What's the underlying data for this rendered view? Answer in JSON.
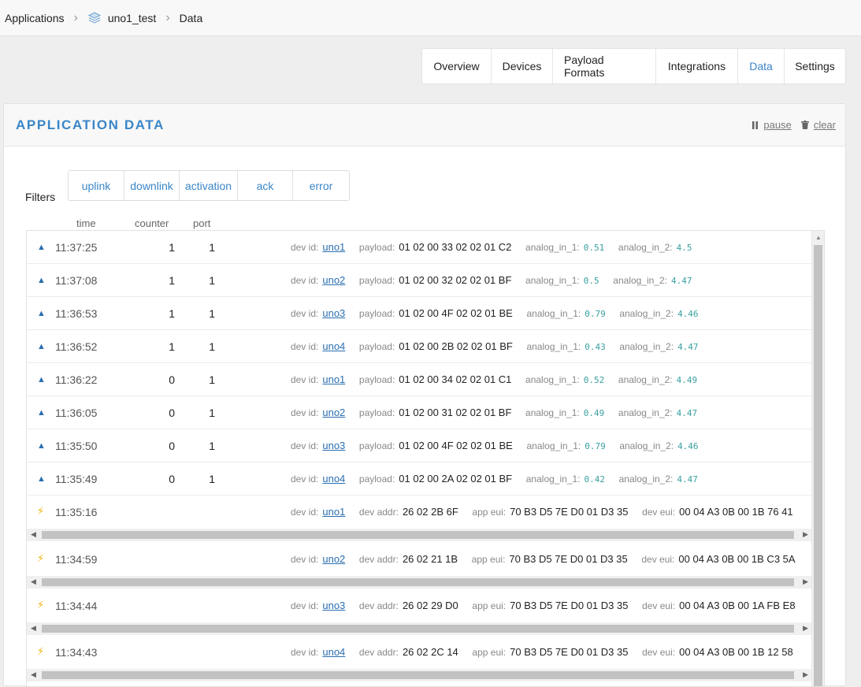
{
  "breadcrumb": {
    "root": "Applications",
    "app": "uno1_test",
    "page": "Data"
  },
  "tabs": [
    {
      "label": "Overview"
    },
    {
      "label": "Devices"
    },
    {
      "label": "Payload Formats"
    },
    {
      "label": "Integrations"
    },
    {
      "label": "Data",
      "active": true
    },
    {
      "label": "Settings"
    }
  ],
  "panel": {
    "title": "APPLICATION DATA",
    "pause_label": "pause",
    "clear_label": "clear"
  },
  "filters": {
    "label": "Filters",
    "items": [
      "uplink",
      "downlink",
      "activation",
      "ack",
      "error"
    ]
  },
  "columns": {
    "time": "time",
    "counter": "counter",
    "port": "port"
  },
  "field_labels": {
    "dev_id": "dev id:",
    "payload": "payload:",
    "analog_in_1": "analog_in_1:",
    "analog_in_2": "analog_in_2:",
    "dev_addr": "dev addr:",
    "app_eui": "app eui:",
    "dev_eui": "dev eui:"
  },
  "uplinks": [
    {
      "time": "11:37:25",
      "counter": "1",
      "port": "1",
      "dev_id": "uno1",
      "payload": "01 02 00 33 02 02 01 C2",
      "analog_in_1": "0.51",
      "analog_in_2": "4.5"
    },
    {
      "time": "11:37:08",
      "counter": "1",
      "port": "1",
      "dev_id": "uno2",
      "payload": "01 02 00 32 02 02 01 BF",
      "analog_in_1": "0.5",
      "analog_in_2": "4.47"
    },
    {
      "time": "11:36:53",
      "counter": "1",
      "port": "1",
      "dev_id": "uno3",
      "payload": "01 02 00 4F 02 02 01 BE",
      "analog_in_1": "0.79",
      "analog_in_2": "4.46"
    },
    {
      "time": "11:36:52",
      "counter": "1",
      "port": "1",
      "dev_id": "uno4",
      "payload": "01 02 00 2B 02 02 01 BF",
      "analog_in_1": "0.43",
      "analog_in_2": "4.47"
    },
    {
      "time": "11:36:22",
      "counter": "0",
      "port": "1",
      "dev_id": "uno1",
      "payload": "01 02 00 34 02 02 01 C1",
      "analog_in_1": "0.52",
      "analog_in_2": "4.49"
    },
    {
      "time": "11:36:05",
      "counter": "0",
      "port": "1",
      "dev_id": "uno2",
      "payload": "01 02 00 31 02 02 01 BF",
      "analog_in_1": "0.49",
      "analog_in_2": "4.47"
    },
    {
      "time": "11:35:50",
      "counter": "0",
      "port": "1",
      "dev_id": "uno3",
      "payload": "01 02 00 4F 02 02 01 BE",
      "analog_in_1": "0.79",
      "analog_in_2": "4.46"
    },
    {
      "time": "11:35:49",
      "counter": "0",
      "port": "1",
      "dev_id": "uno4",
      "payload": "01 02 00 2A 02 02 01 BF",
      "analog_in_1": "0.42",
      "analog_in_2": "4.47"
    }
  ],
  "activations": [
    {
      "time": "11:35:16",
      "dev_id": "uno1",
      "dev_addr": "26 02 2B 6F",
      "app_eui": "70 B3 D5 7E D0 01 D3 35",
      "dev_eui": "00 04 A3 0B 00 1B 76 41"
    },
    {
      "time": "11:34:59",
      "dev_id": "uno2",
      "dev_addr": "26 02 21 1B",
      "app_eui": "70 B3 D5 7E D0 01 D3 35",
      "dev_eui": "00 04 A3 0B 00 1B C3 5A"
    },
    {
      "time": "11:34:44",
      "dev_id": "uno3",
      "dev_addr": "26 02 29 D0",
      "app_eui": "70 B3 D5 7E D0 01 D3 35",
      "dev_eui": "00 04 A3 0B 00 1A FB E8"
    },
    {
      "time": "11:34:43",
      "dev_id": "uno4",
      "dev_addr": "26 02 2C 14",
      "app_eui": "70 B3 D5 7E D0 01 D3 35",
      "dev_eui": "00 04 A3 0B 00 1B 12 58"
    }
  ],
  "icons": {
    "uplink": "triangle-up-icon",
    "activation": "lightning-icon",
    "app": "stack-layers-icon",
    "pause": "pause-icon",
    "clear": "trash-icon"
  },
  "colors": {
    "accent": "#3a86c8",
    "link": "#2b6fb0",
    "activation": "#f0b100",
    "numeric": "#3a9f9f"
  }
}
